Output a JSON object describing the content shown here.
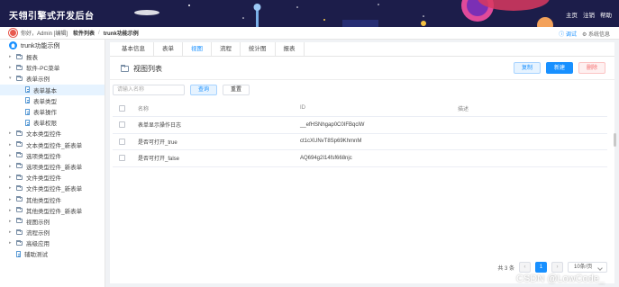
{
  "header": {
    "brand": "天翎引擎式开发后台",
    "nav": [
      "主页",
      "注销",
      "帮助"
    ]
  },
  "subbar": {
    "greeting": "你好，Admin [编辑]",
    "crumbs": [
      "软件列表",
      "trunk功能示例"
    ],
    "right": [
      "调试",
      "系统信息"
    ]
  },
  "sidebar": {
    "root": "trunk功能示例",
    "items": [
      {
        "label": "报表",
        "type": "folder",
        "level": 1
      },
      {
        "label": "软件-PC菜单",
        "type": "folder",
        "level": 1
      },
      {
        "label": "表单示例",
        "type": "folder",
        "level": 1,
        "expanded": true
      },
      {
        "label": "表单基本",
        "type": "doc",
        "level": 2,
        "active": true
      },
      {
        "label": "表单类型",
        "type": "doc",
        "level": 2
      },
      {
        "label": "表单操作",
        "type": "doc",
        "level": 2
      },
      {
        "label": "表单权限",
        "type": "doc",
        "level": 2
      },
      {
        "label": "文本类型控件",
        "type": "folder",
        "level": 1
      },
      {
        "label": "文本类型控件_新表单",
        "type": "folder",
        "level": 1
      },
      {
        "label": "选项类型控件",
        "type": "folder",
        "level": 1
      },
      {
        "label": "选项类型控件_新表单",
        "type": "folder",
        "level": 1
      },
      {
        "label": "文件类型控件",
        "type": "folder",
        "level": 1
      },
      {
        "label": "文件类型控件_新表单",
        "type": "folder",
        "level": 1
      },
      {
        "label": "其他类型控件",
        "type": "folder",
        "level": 1
      },
      {
        "label": "其他类型控件_新表单",
        "type": "folder",
        "level": 1
      },
      {
        "label": "视图示例",
        "type": "folder",
        "level": 1
      },
      {
        "label": "流程示例",
        "type": "folder",
        "level": 1
      },
      {
        "label": "高级应用",
        "type": "folder",
        "level": 1
      },
      {
        "label": "辅助测试",
        "type": "doc",
        "level": 1
      }
    ]
  },
  "tabs": [
    {
      "label": "基本信息"
    },
    {
      "label": "表单"
    },
    {
      "label": "视图",
      "active": true
    },
    {
      "label": "流程"
    },
    {
      "label": "统计图"
    },
    {
      "label": "报表"
    }
  ],
  "panel": {
    "title": "视图列表",
    "copy": "复制",
    "new": "新建",
    "delete": "删除"
  },
  "search": {
    "placeholder": "请输入名称",
    "query": "查询",
    "reset": "重置"
  },
  "table": {
    "headers": [
      "名称",
      "ID",
      "描述"
    ],
    "rows": [
      {
        "name": "表单显示操作日志",
        "id": "__efHSNhgap0C0IFBqclW",
        "desc": ""
      },
      {
        "name": "是否可打开_true",
        "id": "ct1cXUNvT8Sp69KhmnM",
        "desc": ""
      },
      {
        "name": "是否可打开_false",
        "id": "AQ694g2I14fsf668njc",
        "desc": ""
      }
    ]
  },
  "pager": {
    "total": "共 3 条",
    "current": "1",
    "size": "10条/页"
  },
  "watermark": "CSDN @LowCode_"
}
